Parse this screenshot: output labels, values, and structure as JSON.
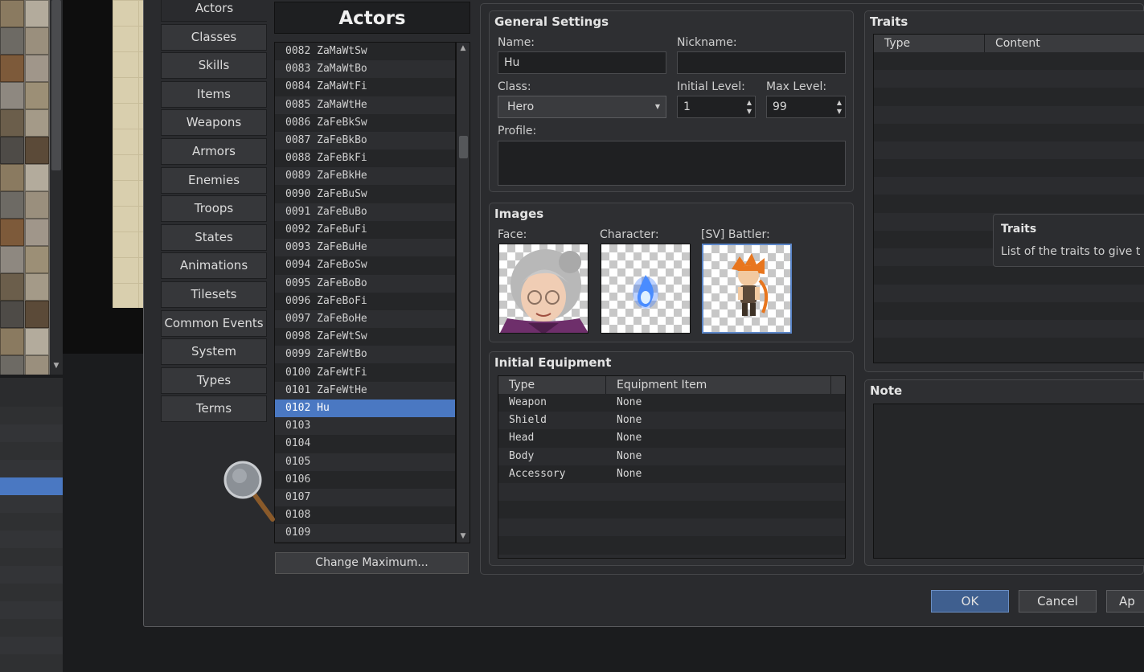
{
  "nav": {
    "items": [
      "Actors",
      "Classes",
      "Skills",
      "Items",
      "Weapons",
      "Armors",
      "Enemies",
      "Troops",
      "States",
      "Animations",
      "Tilesets",
      "Common Events",
      "System",
      "Types",
      "Terms"
    ],
    "selected": "Actors"
  },
  "list": {
    "title": "Actors",
    "items": [
      "0082 ZaMaWtSw",
      "0083 ZaMaWtBo",
      "0084 ZaMaWtFi",
      "0085 ZaMaWtHe",
      "0086 ZaFeBkSw",
      "0087 ZaFeBkBo",
      "0088 ZaFeBkFi",
      "0089 ZaFeBkHe",
      "0090 ZaFeBuSw",
      "0091 ZaFeBuBo",
      "0092 ZaFeBuFi",
      "0093 ZaFeBuHe",
      "0094 ZaFeBoSw",
      "0095 ZaFeBoBo",
      "0096 ZaFeBoFi",
      "0097 ZaFeBoHe",
      "0098 ZaFeWtSw",
      "0099 ZaFeWtBo",
      "0100 ZaFeWtFi",
      "0101 ZaFeWtHe",
      "0102 Hu",
      "0103",
      "0104",
      "0105",
      "0106",
      "0107",
      "0108",
      "0109"
    ],
    "selected_index": 20,
    "change_max_label": "Change Maximum..."
  },
  "general": {
    "title": "General Settings",
    "name_label": "Name:",
    "name_value": "Hu",
    "nickname_label": "Nickname:",
    "nickname_value": "",
    "class_label": "Class:",
    "class_value": "Hero",
    "initial_level_label": "Initial Level:",
    "initial_level_value": "1",
    "max_level_label": "Max Level:",
    "max_level_value": "99",
    "profile_label": "Profile:",
    "profile_value": ""
  },
  "images": {
    "title": "Images",
    "face_label": "Face:",
    "character_label": "Character:",
    "battler_label": "[SV] Battler:"
  },
  "equipment": {
    "title": "Initial Equipment",
    "col_type": "Type",
    "col_item": "Equipment Item",
    "rows": [
      {
        "type": "Weapon",
        "item": "None"
      },
      {
        "type": "Shield",
        "item": "None"
      },
      {
        "type": "Head",
        "item": "None"
      },
      {
        "type": "Body",
        "item": "None"
      },
      {
        "type": "Accessory",
        "item": "None"
      }
    ]
  },
  "traits": {
    "title": "Traits",
    "col_type": "Type",
    "col_content": "Content",
    "tooltip_title": "Traits",
    "tooltip_text": "List of the traits to give t"
  },
  "note": {
    "title": "Note"
  },
  "buttons": {
    "ok": "OK",
    "cancel": "Cancel",
    "apply": "Ap"
  },
  "colors": {
    "selection": "#4a78c2",
    "dialog_bg": "#2a2b2e"
  }
}
